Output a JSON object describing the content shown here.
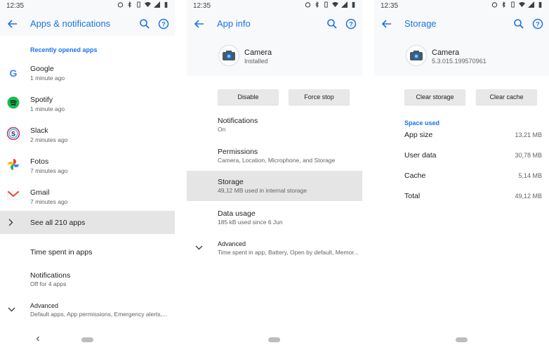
{
  "status": {
    "time": "12:35"
  },
  "screen1": {
    "title": "Apps & notifications",
    "section": "Recently opened apps",
    "apps": [
      {
        "name": "Google",
        "time": "1 minute ago"
      },
      {
        "name": "Spotify",
        "time": "1 minute ago"
      },
      {
        "name": "Slack",
        "time": "2 minutes ago"
      },
      {
        "name": "Fotos",
        "time": "7 minutes ago"
      },
      {
        "name": "Gmail",
        "time": "7 minutes ago"
      }
    ],
    "see_all": "See all 210 apps",
    "time_spent": "Time spent in apps",
    "notifications": {
      "title": "Notifications",
      "sub": "Off for 4 apps"
    },
    "advanced": {
      "title": "Advanced",
      "sub": "Default apps, App permissions, Emergency alerts,..."
    }
  },
  "screen2": {
    "title": "App info",
    "app": {
      "name": "Camera",
      "status": "Installed"
    },
    "buttons": {
      "disable": "Disable",
      "force_stop": "Force stop"
    },
    "items": [
      {
        "title": "Notifications",
        "sub": "On"
      },
      {
        "title": "Permissions",
        "sub": "Camera, Location, Microphone, and Storage"
      },
      {
        "title": "Storage",
        "sub": "49,12 MB used in internal storage"
      },
      {
        "title": "Data usage",
        "sub": "185 kB used since 6 Jun"
      }
    ],
    "advanced": {
      "title": "Advanced",
      "sub": "Time spent in app, Battery, Open by default, Memor..."
    }
  },
  "screen3": {
    "title": "Storage",
    "app": {
      "name": "Camera",
      "version": "5.3.015.199570961"
    },
    "buttons": {
      "clear_storage": "Clear storage",
      "clear_cache": "Clear cache"
    },
    "section": "Space used",
    "rows": [
      {
        "label": "App size",
        "value": "13,21 MB"
      },
      {
        "label": "User data",
        "value": "30,78 MB"
      },
      {
        "label": "Cache",
        "value": "5,14 MB"
      },
      {
        "label": "Total",
        "value": "49,12 MB"
      }
    ]
  },
  "colors": {
    "accent": "#1a73e8",
    "highlight": "#e5e5e5",
    "appbar": "#f8f9fa"
  },
  "icons": [
    "back-arrow-icon",
    "search-icon",
    "help-icon",
    "chevron-right-icon",
    "chevron-down-icon",
    "camera-icon",
    "google-icon",
    "spotify-icon",
    "slack-icon",
    "photos-icon",
    "gmail-icon"
  ]
}
